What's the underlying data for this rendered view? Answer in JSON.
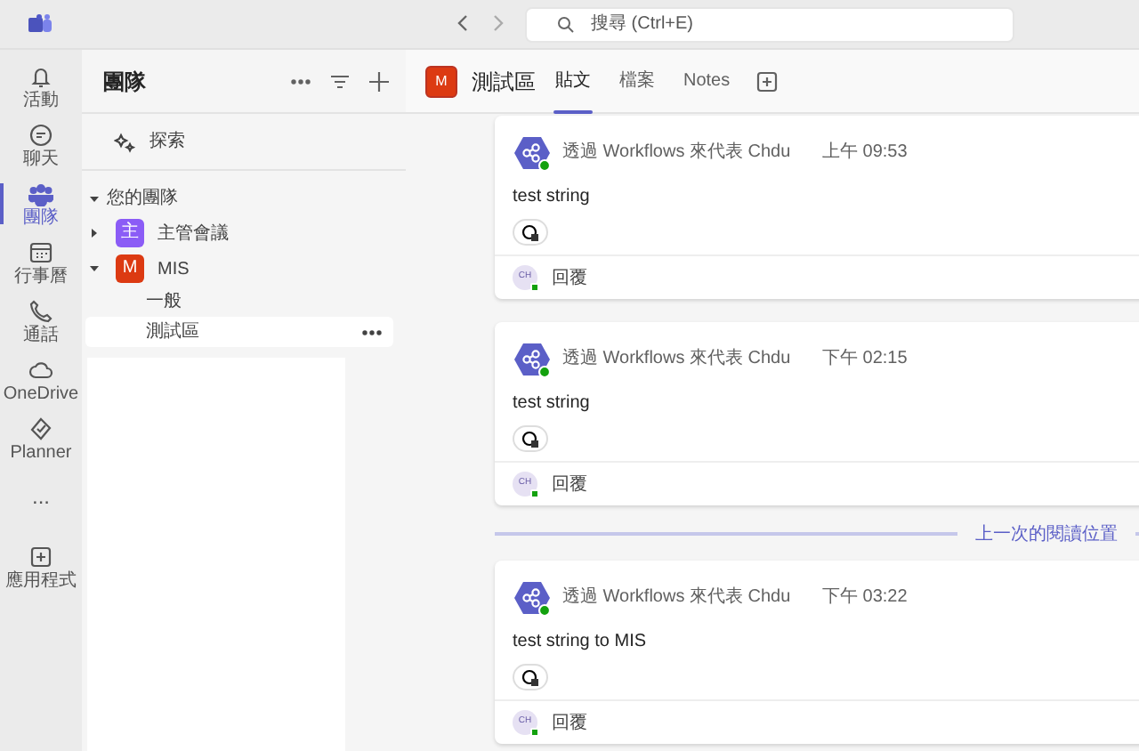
{
  "top_bar": {
    "search": {
      "placeholder": "搜尋 (Ctrl+E)"
    }
  },
  "rail": [
    {
      "kind": "bell",
      "label": "活動",
      "selected": false
    },
    {
      "kind": "chat",
      "label": "聊天",
      "selected": false
    },
    {
      "kind": "teams",
      "label": "團隊",
      "selected": true
    },
    {
      "kind": "calendar",
      "label": "行事曆",
      "selected": false
    },
    {
      "kind": "phone",
      "label": "通話",
      "selected": false
    },
    {
      "kind": "cloud",
      "label": "OneDrive",
      "selected": false
    },
    {
      "kind": "planner",
      "label": "Planner",
      "selected": false
    },
    {
      "kind": "more",
      "label": "...",
      "selected": false
    },
    {
      "kind": "apps",
      "label": "應用程式",
      "selected": false
    }
  ],
  "teams_panel": {
    "title": "團隊",
    "discover": "探索",
    "section": "您的團隊",
    "teams": [
      {
        "initial": "主",
        "name": "主管會議",
        "color": "#8b5cf6",
        "expanded": false
      },
      {
        "initial": "M",
        "name": "MIS",
        "color": "#dc3a12",
        "expanded": true,
        "channels": [
          {
            "name": "一般",
            "selected": false
          },
          {
            "name": "測試區",
            "selected": true
          }
        ]
      }
    ]
  },
  "channel_header": {
    "initial": "M",
    "title": "測試區",
    "tabs": [
      {
        "label": "貼文",
        "selected": true
      },
      {
        "label": "檔案",
        "selected": false
      },
      {
        "label": "Notes",
        "selected": false
      }
    ]
  },
  "feed": [
    {
      "kind": "post",
      "author": "透過 Workflows 來代表 Chdu",
      "time": "上午 09:53",
      "body": "test string",
      "reply_avatar": "CH",
      "reply": "回覆"
    },
    {
      "kind": "post",
      "author": "透過 Workflows 來代表 Chdu",
      "time": "下午 02:15",
      "body": "test string",
      "reply_avatar": "CH",
      "reply": "回覆"
    },
    {
      "kind": "divider",
      "label": "上一次的閱讀位置"
    },
    {
      "kind": "post",
      "author": "透過 Workflows 來代表 Chdu",
      "time": "下午 03:22",
      "body": "test string to MIS",
      "reply_avatar": "CH",
      "reply": "回覆"
    }
  ]
}
